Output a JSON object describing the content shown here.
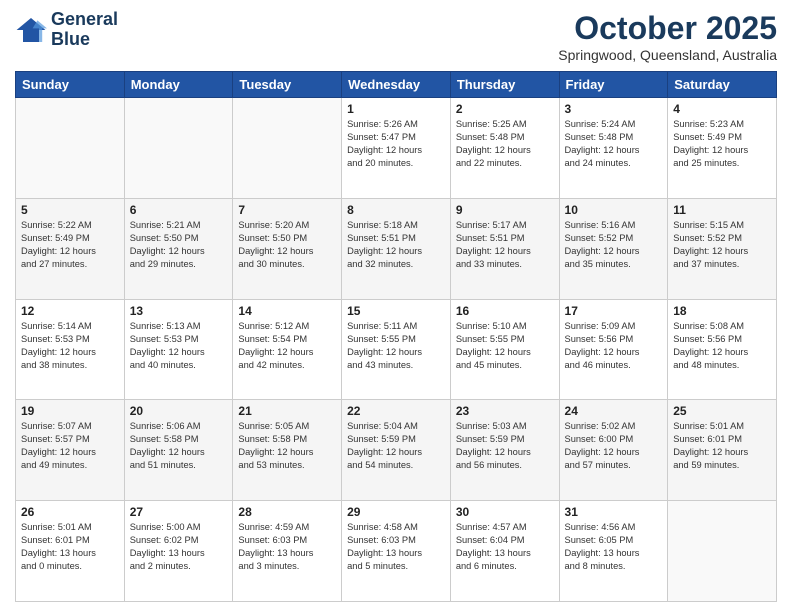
{
  "header": {
    "logo_line1": "General",
    "logo_line2": "Blue",
    "month": "October 2025",
    "location": "Springwood, Queensland, Australia"
  },
  "weekdays": [
    "Sunday",
    "Monday",
    "Tuesday",
    "Wednesday",
    "Thursday",
    "Friday",
    "Saturday"
  ],
  "weeks": [
    [
      {
        "day": "",
        "info": ""
      },
      {
        "day": "",
        "info": ""
      },
      {
        "day": "",
        "info": ""
      },
      {
        "day": "1",
        "info": "Sunrise: 5:26 AM\nSunset: 5:47 PM\nDaylight: 12 hours\nand 20 minutes."
      },
      {
        "day": "2",
        "info": "Sunrise: 5:25 AM\nSunset: 5:48 PM\nDaylight: 12 hours\nand 22 minutes."
      },
      {
        "day": "3",
        "info": "Sunrise: 5:24 AM\nSunset: 5:48 PM\nDaylight: 12 hours\nand 24 minutes."
      },
      {
        "day": "4",
        "info": "Sunrise: 5:23 AM\nSunset: 5:49 PM\nDaylight: 12 hours\nand 25 minutes."
      }
    ],
    [
      {
        "day": "5",
        "info": "Sunrise: 5:22 AM\nSunset: 5:49 PM\nDaylight: 12 hours\nand 27 minutes."
      },
      {
        "day": "6",
        "info": "Sunrise: 5:21 AM\nSunset: 5:50 PM\nDaylight: 12 hours\nand 29 minutes."
      },
      {
        "day": "7",
        "info": "Sunrise: 5:20 AM\nSunset: 5:50 PM\nDaylight: 12 hours\nand 30 minutes."
      },
      {
        "day": "8",
        "info": "Sunrise: 5:18 AM\nSunset: 5:51 PM\nDaylight: 12 hours\nand 32 minutes."
      },
      {
        "day": "9",
        "info": "Sunrise: 5:17 AM\nSunset: 5:51 PM\nDaylight: 12 hours\nand 33 minutes."
      },
      {
        "day": "10",
        "info": "Sunrise: 5:16 AM\nSunset: 5:52 PM\nDaylight: 12 hours\nand 35 minutes."
      },
      {
        "day": "11",
        "info": "Sunrise: 5:15 AM\nSunset: 5:52 PM\nDaylight: 12 hours\nand 37 minutes."
      }
    ],
    [
      {
        "day": "12",
        "info": "Sunrise: 5:14 AM\nSunset: 5:53 PM\nDaylight: 12 hours\nand 38 minutes."
      },
      {
        "day": "13",
        "info": "Sunrise: 5:13 AM\nSunset: 5:53 PM\nDaylight: 12 hours\nand 40 minutes."
      },
      {
        "day": "14",
        "info": "Sunrise: 5:12 AM\nSunset: 5:54 PM\nDaylight: 12 hours\nand 42 minutes."
      },
      {
        "day": "15",
        "info": "Sunrise: 5:11 AM\nSunset: 5:55 PM\nDaylight: 12 hours\nand 43 minutes."
      },
      {
        "day": "16",
        "info": "Sunrise: 5:10 AM\nSunset: 5:55 PM\nDaylight: 12 hours\nand 45 minutes."
      },
      {
        "day": "17",
        "info": "Sunrise: 5:09 AM\nSunset: 5:56 PM\nDaylight: 12 hours\nand 46 minutes."
      },
      {
        "day": "18",
        "info": "Sunrise: 5:08 AM\nSunset: 5:56 PM\nDaylight: 12 hours\nand 48 minutes."
      }
    ],
    [
      {
        "day": "19",
        "info": "Sunrise: 5:07 AM\nSunset: 5:57 PM\nDaylight: 12 hours\nand 49 minutes."
      },
      {
        "day": "20",
        "info": "Sunrise: 5:06 AM\nSunset: 5:58 PM\nDaylight: 12 hours\nand 51 minutes."
      },
      {
        "day": "21",
        "info": "Sunrise: 5:05 AM\nSunset: 5:58 PM\nDaylight: 12 hours\nand 53 minutes."
      },
      {
        "day": "22",
        "info": "Sunrise: 5:04 AM\nSunset: 5:59 PM\nDaylight: 12 hours\nand 54 minutes."
      },
      {
        "day": "23",
        "info": "Sunrise: 5:03 AM\nSunset: 5:59 PM\nDaylight: 12 hours\nand 56 minutes."
      },
      {
        "day": "24",
        "info": "Sunrise: 5:02 AM\nSunset: 6:00 PM\nDaylight: 12 hours\nand 57 minutes."
      },
      {
        "day": "25",
        "info": "Sunrise: 5:01 AM\nSunset: 6:01 PM\nDaylight: 12 hours\nand 59 minutes."
      }
    ],
    [
      {
        "day": "26",
        "info": "Sunrise: 5:01 AM\nSunset: 6:01 PM\nDaylight: 13 hours\nand 0 minutes."
      },
      {
        "day": "27",
        "info": "Sunrise: 5:00 AM\nSunset: 6:02 PM\nDaylight: 13 hours\nand 2 minutes."
      },
      {
        "day": "28",
        "info": "Sunrise: 4:59 AM\nSunset: 6:03 PM\nDaylight: 13 hours\nand 3 minutes."
      },
      {
        "day": "29",
        "info": "Sunrise: 4:58 AM\nSunset: 6:03 PM\nDaylight: 13 hours\nand 5 minutes."
      },
      {
        "day": "30",
        "info": "Sunrise: 4:57 AM\nSunset: 6:04 PM\nDaylight: 13 hours\nand 6 minutes."
      },
      {
        "day": "31",
        "info": "Sunrise: 4:56 AM\nSunset: 6:05 PM\nDaylight: 13 hours\nand 8 minutes."
      },
      {
        "day": "",
        "info": ""
      }
    ]
  ]
}
